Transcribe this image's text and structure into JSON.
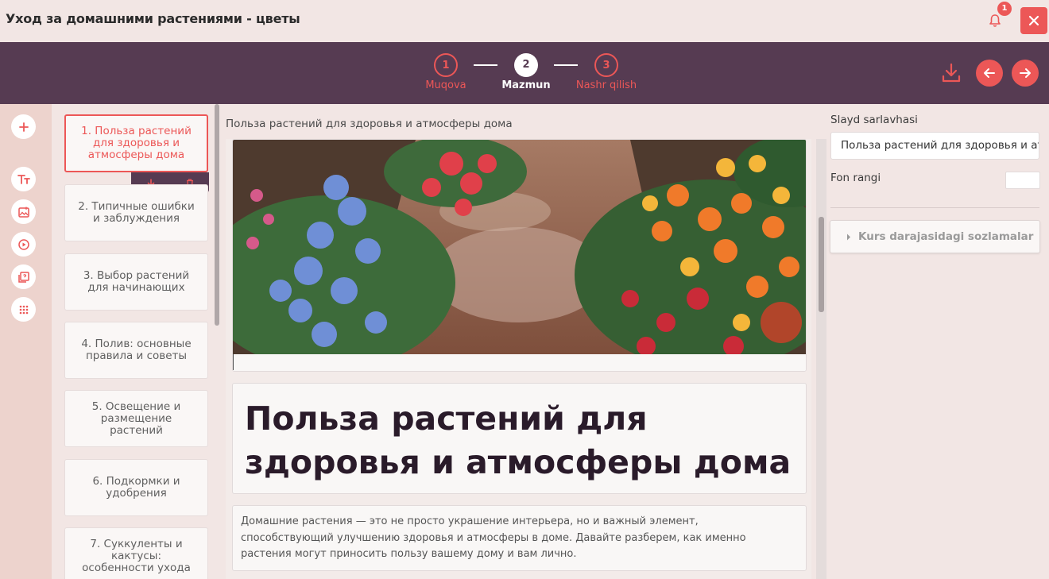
{
  "app": {
    "title": "Уход за домашними растениями - цветы",
    "notification_count": "1"
  },
  "steps": [
    {
      "number": "1",
      "label": "Muqova",
      "active": false
    },
    {
      "number": "2",
      "label": "Mazmun",
      "active": true
    },
    {
      "number": "3",
      "label": "Nashr qilish",
      "active": false
    }
  ],
  "toolbar_icons": [
    "plus-icon",
    "text-icon",
    "image-icon",
    "video-icon",
    "quiz-icon",
    "grid-icon"
  ],
  "slides": [
    {
      "label": "1. Польза растений для здоровья и атмосферы дома",
      "selected": true
    },
    {
      "label": "2. Типичные ошибки и заблуждения",
      "selected": false
    },
    {
      "label": "3. Выбор растений для начинающих",
      "selected": false
    },
    {
      "label": "4. Полив: основные правила и советы",
      "selected": false
    },
    {
      "label": "5. Освещение и размещение растений",
      "selected": false
    },
    {
      "label": "6. Подкормки и удобрения",
      "selected": false
    },
    {
      "label": "7. Суккуленты и кактусы: особенности ухода",
      "selected": false
    }
  ],
  "editor": {
    "slide_title": "Польза растений для здоровья и атмосферы дома",
    "heading": "Польза растений для здоровья и атмосферы дома",
    "paragraph": "Домашние растения — это не просто украшение интерьера, но и важный элемент, способствующий улучшению здоровья и атмосферы в доме. Давайте разберем, как именно растения могут приносить пользу вашему дому и вам лично."
  },
  "right_panel": {
    "title_label": "Slayd sarlavhasi",
    "title_value": "Польза растений для здоровья и атмосферы дома",
    "bg_color_label": "Fon rangi",
    "bg_color_value": "#ffffff",
    "course_settings_label": "Kurs darajasidagi sozlamalar"
  },
  "colors": {
    "accent": "#ec5757",
    "header_bg": "#563b52",
    "page_bg": "#f2e6e4"
  }
}
